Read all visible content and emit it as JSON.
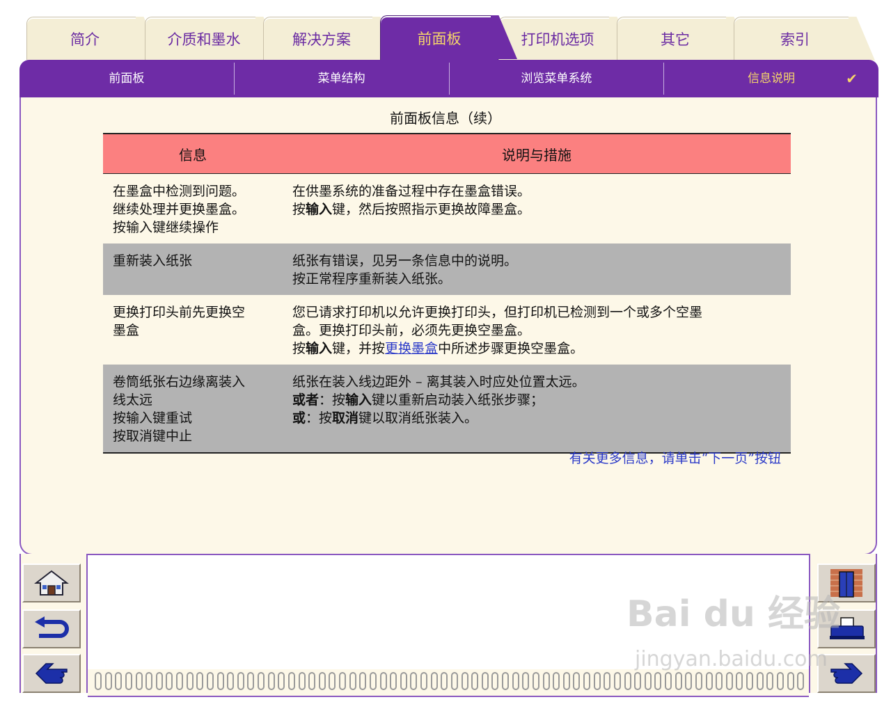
{
  "tabs": [
    {
      "label": "简介"
    },
    {
      "label": "介质和墨水"
    },
    {
      "label": "解决方案"
    },
    {
      "label": "前面板"
    },
    {
      "label": "打印机选项"
    },
    {
      "label": "其它"
    },
    {
      "label": "索引"
    }
  ],
  "subnav": [
    {
      "label": "前面板"
    },
    {
      "label": "菜单结构"
    },
    {
      "label": "浏览菜单系统"
    },
    {
      "label": "信息说明"
    }
  ],
  "check_mark": "✔",
  "page_title": "前面板信息（续）",
  "table": {
    "headers": [
      "信息",
      "说明与措施"
    ],
    "rows": [
      {
        "info": [
          "在墨盒中检测到问题。",
          "继续处理并更换墨盒。",
          "按输入键继续操作"
        ],
        "desc": {
          "l1": "在供墨系统的准备过程中存在墨盒错误。",
          "l2a": "按",
          "l2b": "输入",
          "l2c": "键，然后按照指示更换故障墨盒。"
        }
      },
      {
        "info": [
          "重新装入纸张"
        ],
        "desc": {
          "l1": "纸张有错误，见另一条信息中的说明。",
          "l2": "按正常程序重新装入纸张。"
        }
      },
      {
        "info": [
          "更换打印头前先更换空",
          "墨盒"
        ],
        "desc": {
          "l1": "您已请求打印机以允许更换打印头，但打印机已检测到一个或多个空墨",
          "l2": "盒。更换打印头前，必须先更换空墨盒。",
          "l3a": "按",
          "l3b": "输入",
          "l3c": "键，并按",
          "l3link": "更换墨盒",
          "l3d": "中所述步骤更换空墨盒。"
        }
      },
      {
        "info": [
          "卷筒纸张右边缘离装入",
          "线太远",
          "按输入键重试",
          "按取消键中止"
        ],
        "desc": {
          "l1": "纸张在装入线边距外 – 离其装入时应处位置太远。",
          "l2a": "或者",
          "l2b": "：按",
          "l2c": "输入",
          "l2d": "键以重新启动装入纸张步骤；",
          "l3a": "或",
          "l3b": "：按",
          "l3c": "取消",
          "l3d": "键以取消纸张装入。"
        }
      }
    ]
  },
  "more_info": "有关更多信息，请单击“下一页”按钮",
  "nav_icons": [
    "home-icon",
    "back-arrow-icon",
    "previous-page-icon",
    "exit-door-icon",
    "print-icon",
    "next-page-icon"
  ],
  "watermark": {
    "line1": "Bai du 经验",
    "line2": "jingyan.baidu.com"
  },
  "colors": {
    "accent": "#6e2ca6",
    "tab_active_text": "#f6d66a",
    "header_bg": "#fb8080",
    "row_gray": "#b3b3b3",
    "link": "#2a39c8"
  }
}
